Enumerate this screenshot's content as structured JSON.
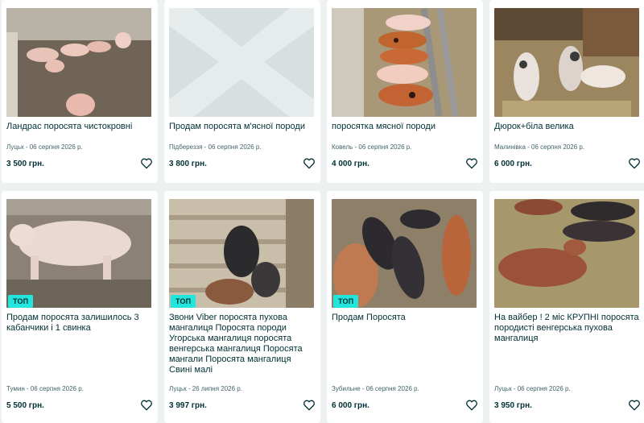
{
  "badge_label": "ТОП",
  "listings": [
    {
      "title": "Ландрас поросята чистокровні",
      "meta": "Луцьк - 06 серпня 2026 р.",
      "price": "3 500 грн.",
      "image_alt": "pigs-in-pen-photo",
      "top": false
    },
    {
      "title": "Продам поросята м'ясної породи",
      "meta": "Підбереззя - 06 серпня 2026 р.",
      "price": "3 800 грн.",
      "image_alt": "no-photo-placeholder",
      "top": false
    },
    {
      "title": "поросятка мясної породи",
      "meta": "Ковель - 06 серпня 2026 р.",
      "price": "4 000 грн.",
      "image_alt": "spotted-piglets-photo",
      "top": false
    },
    {
      "title": "Дюрок+біла велика",
      "meta": "Малинівка - 06 серпня 2026 р.",
      "price": "6 000 грн.",
      "image_alt": "spotted-pigs-photo",
      "top": false
    },
    {
      "title": "Продам поросята залишилось 3 кабанчики і 1 свинка",
      "meta": "Тумин - 06 серпня 2026 р.",
      "price": "5 500 грн.",
      "image_alt": "white-pig-photo",
      "top": true
    },
    {
      "title": "Звони Viber поросята пухова мангалиця Поросята породи Угорська мангалиця поросята венгерська мангалиця Поросята мангали Поросята мангалиця Свині малі",
      "meta": "Луцьк - 26 липня 2026 р.",
      "price": "3 997 грн.",
      "image_alt": "mangalica-piglets-photo",
      "top": true
    },
    {
      "title": "Продам Поросята",
      "meta": "Зубильне - 06 серпня 2026 р.",
      "price": "6 000 грн.",
      "image_alt": "black-and-red-piglets-photo",
      "top": true
    },
    {
      "title": "На вайбер ! 2 міс КРУПНІ поросята породисті венгерська пухова мангалиця",
      "meta": "Луцьк - 06 серпня 2026 р.",
      "price": "3 950 грн.",
      "image_alt": "piglets-on-hay-photo",
      "top": false
    }
  ],
  "colors": {
    "badge": "#23e5db",
    "text": "#002f34",
    "meta": "#406367",
    "background": "#eef1f1"
  }
}
